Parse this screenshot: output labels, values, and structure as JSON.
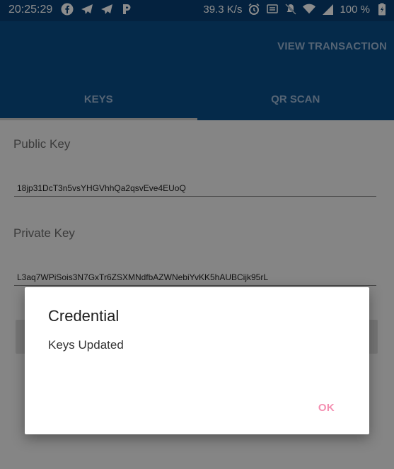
{
  "status_bar": {
    "time": "20:25:29",
    "speed": "39.3 K/s",
    "battery": "100 %",
    "left_icons": [
      "facebook-icon",
      "send-icon",
      "send-icon",
      "parking-icon"
    ],
    "right_icons": [
      "alarm-icon",
      "cast-icon",
      "muted-icon",
      "wifi-icon",
      "signal-icon",
      "battery-icon"
    ]
  },
  "app_bar": {
    "action": "VIEW TRANSACTION",
    "tabs": [
      {
        "label": "KEYS",
        "active": true
      },
      {
        "label": "QR SCAN",
        "active": false
      }
    ]
  },
  "form": {
    "public_key_label": "Public Key",
    "public_key_value": "18jp31DcT3n5vsYHGVhhQa2qsvEve4EUoQ",
    "private_key_label": "Private Key",
    "private_key_value": "L3aq7WPiSois3N7GxTr6ZSXMNdfbAZWNebiYvKK5hAUBCijk95rL"
  },
  "dialog": {
    "title": "Credential",
    "message": "Keys Updated",
    "ok": "OK"
  },
  "colors": {
    "status_bar": "#083f73",
    "app_bar": "#0a4d87",
    "tab_text": "#9cb6d3",
    "dialog_button": "#f48fb1"
  }
}
